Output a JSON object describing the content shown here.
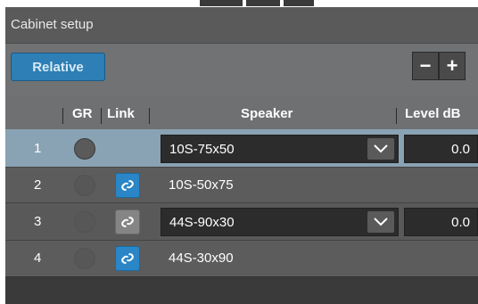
{
  "window": {
    "title": "Cabinet setup"
  },
  "toolbar": {
    "relative_label": "Relative",
    "minus_label": "−",
    "plus_label": "+"
  },
  "table": {
    "headers": {
      "gr": "GR",
      "link": "Link",
      "speaker": "Speaker",
      "level": "Level dB"
    },
    "rows": [
      {
        "num": "1",
        "gr_icon": "gr-indicator",
        "link_visible": false,
        "link_active": false,
        "speaker": "10S-75x50",
        "has_dropdown": true,
        "level": "0.0",
        "selected": true
      },
      {
        "num": "2",
        "gr_icon": "gr-indicator",
        "link_visible": true,
        "link_active": true,
        "speaker": "10S-50x75",
        "has_dropdown": false,
        "level": ""
      },
      {
        "num": "3",
        "gr_icon": "gr-indicator",
        "link_visible": true,
        "link_active": false,
        "speaker": "44S-90x30",
        "has_dropdown": true,
        "level": "0.0"
      },
      {
        "num": "4",
        "gr_icon": "gr-indicator",
        "link_visible": true,
        "link_active": true,
        "speaker": "44S-30x90",
        "has_dropdown": false,
        "level": ""
      }
    ]
  },
  "colors": {
    "accent_blue": "#2d7fb5",
    "selected_row": "#8aa3b4",
    "panel_bg": "#333333"
  },
  "icons": {
    "link": "chain-link-icon",
    "dropdown": "chevron-down-icon"
  }
}
